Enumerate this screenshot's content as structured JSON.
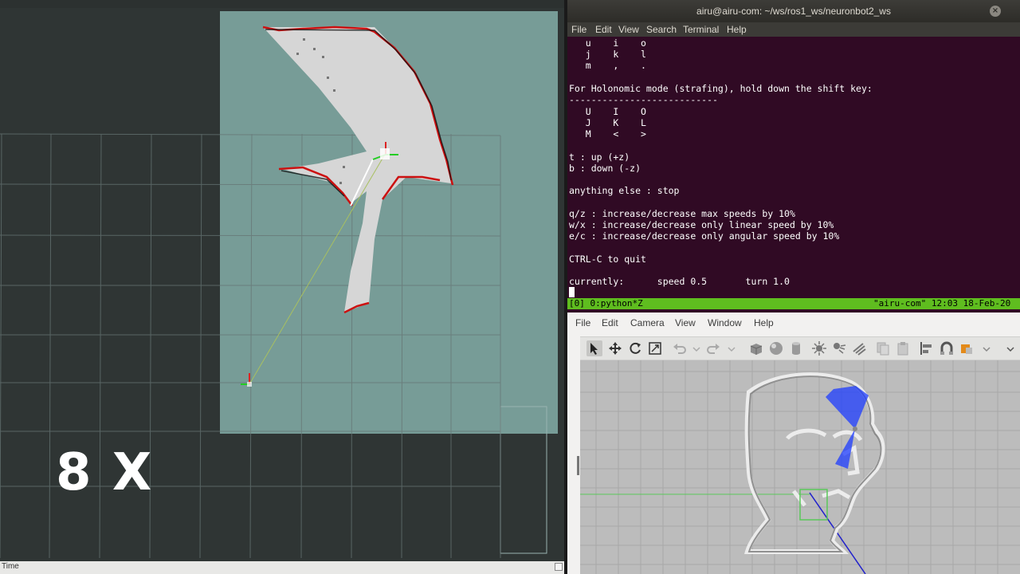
{
  "rviz": {
    "overlay_label": "8 X",
    "status_label": "Time"
  },
  "terminal": {
    "title": "airu@airu-com: ~/ws/ros1_ws/neuronbot2_ws",
    "close_symbol": "×",
    "menu": [
      "File",
      "Edit",
      "View",
      "Search",
      "Terminal",
      "Help"
    ],
    "lines": [
      "   u    i    o",
      "   j    k    l",
      "   m    ,    .",
      "",
      "For Holonomic mode (strafing), hold down the shift key:",
      "---------------------------",
      "   U    I    O",
      "   J    K    L",
      "   M    <    >",
      "",
      "t : up (+z)",
      "b : down (-z)",
      "",
      "anything else : stop",
      "",
      "q/z : increase/decrease max speeds by 10%",
      "w/x : increase/decrease only linear speed by 10%",
      "e/c : increase/decrease only angular speed by 10%",
      "",
      "CTRL-C to quit",
      "",
      "currently:      speed 0.5       turn 1.0"
    ],
    "tmux_left": "[0] 0:python*Z",
    "tmux_right": "\"airu-com\" 12:03 18-Feb-20"
  },
  "gazebo": {
    "menu": [
      "File",
      "Edit",
      "Camera",
      "View",
      "Window",
      "Help"
    ],
    "toolbar": [
      "select-mode-icon",
      "translate-icon",
      "rotate-icon",
      "scale-icon",
      "undo-icon",
      "undo-dropdown-icon",
      "redo-icon",
      "redo-dropdown-icon",
      "box-icon",
      "sphere-icon",
      "cylinder-icon",
      "point-light-icon",
      "spot-light-icon",
      "directional-light-icon",
      "copy-icon",
      "paste-icon",
      "align-icon",
      "snap-icon",
      "change-view-icon",
      "more-icon"
    ]
  },
  "colors": {
    "terminal_bg": "#300a24",
    "tmux_bar": "#5fbd1f",
    "map_free": "#d2d2d2",
    "map_unknown": "#779c97",
    "laser": "#cc1111",
    "lidar_rays": "#1e3cff"
  }
}
